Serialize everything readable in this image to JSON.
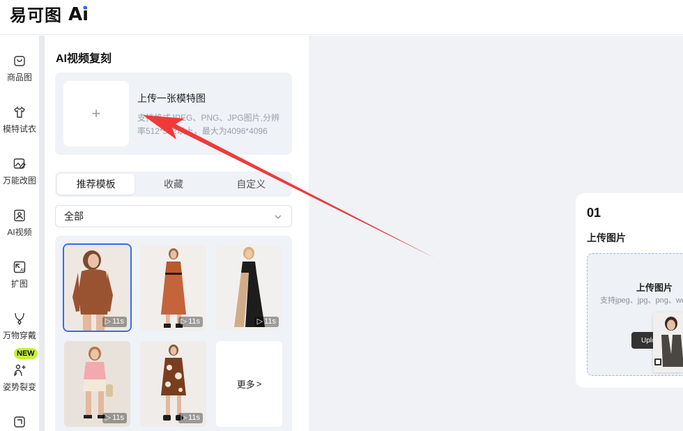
{
  "header": {
    "logo_text": "易可图",
    "logo_ai": "Ai"
  },
  "sidebar": {
    "items": [
      {
        "label": "商品图",
        "icon": "shopping-bag-icon"
      },
      {
        "label": "模特试衣",
        "icon": "tshirt-icon"
      },
      {
        "label": "万能改图",
        "icon": "image-edit-icon"
      },
      {
        "label": "AI视频",
        "icon": "video-icon"
      },
      {
        "label": "扩图",
        "icon": "expand-icon"
      },
      {
        "label": "万物穿戴",
        "icon": "necklace-icon"
      },
      {
        "label": "姿势裂变",
        "icon": "pose-icon"
      },
      {
        "label": "",
        "icon": "bag-icon"
      }
    ],
    "new_badge": "NEW"
  },
  "panel": {
    "title": "AI视频复刻",
    "upload": {
      "plus": "+",
      "heading": "上传一张模特图",
      "hint": "支持格式JPEG、PNG、JPG图片,分辨率512*512以上，最大为4096*4096"
    },
    "tabs": [
      {
        "label": "推荐模板",
        "active": true
      },
      {
        "label": "收藏",
        "active": false
      },
      {
        "label": "自定义",
        "active": false
      }
    ],
    "filter": {
      "selected": "全部"
    },
    "templates": [
      {
        "duration": "11s",
        "selected": true
      },
      {
        "duration": "11s",
        "selected": false
      },
      {
        "duration": "11s",
        "selected": false
      },
      {
        "duration": "11s",
        "selected": false
      },
      {
        "duration": "11s",
        "selected": false
      }
    ],
    "more_label": "更多",
    "more_chevron": ">"
  },
  "main": {
    "step": {
      "number": "01",
      "title": "上传图片",
      "drop_title": "上传图片",
      "drop_hint": "支持jpeg、jpg、png、we",
      "button_label": "Uplo"
    }
  },
  "colors": {
    "accent": "#2b6ff3",
    "badge": "#c6f23a",
    "arrow": "#f03a3a",
    "panel_bg": "#eff2f7"
  }
}
